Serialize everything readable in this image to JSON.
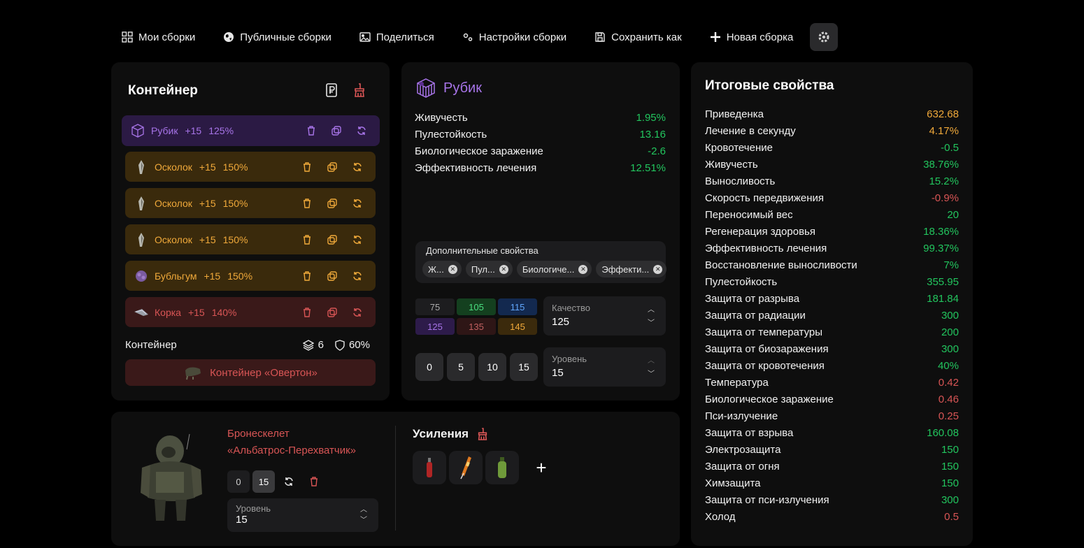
{
  "nav": {
    "my_builds": "Мои сборки",
    "public_builds": "Публичные сборки",
    "share": "Поделиться",
    "build_settings": "Настройки сборки",
    "save_as": "Сохранить как",
    "new_build": "Новая сборка"
  },
  "container": {
    "title": "Контейнер",
    "artifacts": [
      {
        "name": "Рубик",
        "level": "+15",
        "percent": "125%",
        "color": "purple",
        "icon": "rubik-icon"
      },
      {
        "name": "Осколок",
        "level": "+15",
        "percent": "150%",
        "color": "orange",
        "icon": "shard-icon"
      },
      {
        "name": "Осколок",
        "level": "+15",
        "percent": "150%",
        "color": "orange",
        "icon": "shard-icon"
      },
      {
        "name": "Осколок",
        "level": "+15",
        "percent": "150%",
        "color": "orange",
        "icon": "shard-icon"
      },
      {
        "name": "Бубльгум",
        "level": "+15",
        "percent": "150%",
        "color": "orange",
        "icon": "bubblegum-icon"
      },
      {
        "name": "Корка",
        "level": "+15",
        "percent": "140%",
        "color": "red",
        "icon": "crust-icon"
      }
    ],
    "summary_label": "Контейнер",
    "slots": "6",
    "protection": "60%",
    "container_item": "Контейнер «Овертон»"
  },
  "rubik": {
    "title": "Рубик",
    "stats": [
      {
        "name": "Живучесть",
        "value": "1.95%",
        "color": "green"
      },
      {
        "name": "Пулестойкость",
        "value": "13.16",
        "color": "green"
      },
      {
        "name": "Биологическое заражение",
        "value": "-2.6",
        "color": "green"
      },
      {
        "name": "Эффективность лечения",
        "value": "12.51%",
        "color": "green"
      }
    ],
    "extra_label": "Дополнительные свойства",
    "chips": [
      "Ж...",
      "Пул...",
      "Биологиче...",
      "Эффекти..."
    ],
    "quality_values": [
      "75",
      "105",
      "115",
      "125",
      "135",
      "145"
    ],
    "quality_label": "Качество",
    "quality_value": "125",
    "level_buttons": [
      "0",
      "5",
      "10",
      "15"
    ],
    "level_label": "Уровень",
    "level_value": "15"
  },
  "totals": {
    "title": "Итоговые свойства",
    "stats": [
      {
        "name": "Приведенка",
        "value": "632.68",
        "color": "orange"
      },
      {
        "name": "Лечение в секунду",
        "value": "4.17%",
        "color": "orange"
      },
      {
        "name": "Кровотечение",
        "value": "-0.5",
        "color": "green"
      },
      {
        "name": "Живучесть",
        "value": "38.76%",
        "color": "green"
      },
      {
        "name": "Выносливость",
        "value": "15.2%",
        "color": "green"
      },
      {
        "name": "Скорость передвижения",
        "value": "-0.9%",
        "color": "red"
      },
      {
        "name": "Переносимый вес",
        "value": "20",
        "color": "green"
      },
      {
        "name": "Регенерация здоровья",
        "value": "18.36%",
        "color": "green"
      },
      {
        "name": "Эффективность лечения",
        "value": "99.37%",
        "color": "green"
      },
      {
        "name": "Восстановление выносливости",
        "value": "7%",
        "color": "green"
      },
      {
        "name": "Пулестойкость",
        "value": "355.95",
        "color": "green"
      },
      {
        "name": "Защита от разрыва",
        "value": "181.84",
        "color": "green"
      },
      {
        "name": "Защита от радиации",
        "value": "300",
        "color": "green"
      },
      {
        "name": "Защита от температуры",
        "value": "200",
        "color": "green"
      },
      {
        "name": "Защита от биозаражения",
        "value": "300",
        "color": "green"
      },
      {
        "name": "Защита от кровотечения",
        "value": "40%",
        "color": "green"
      },
      {
        "name": "Температура",
        "value": "0.42",
        "color": "red"
      },
      {
        "name": "Биологическое заражение",
        "value": "0.46",
        "color": "red"
      },
      {
        "name": "Пси-излучение",
        "value": "0.25",
        "color": "red"
      },
      {
        "name": "Защита от взрыва",
        "value": "160.08",
        "color": "green"
      },
      {
        "name": "Электрозащита",
        "value": "150",
        "color": "green"
      },
      {
        "name": "Защита от огня",
        "value": "150",
        "color": "green"
      },
      {
        "name": "Химзащита",
        "value": "150",
        "color": "green"
      },
      {
        "name": "Защита от пси-излучения",
        "value": "300",
        "color": "green"
      },
      {
        "name": "Холод",
        "value": "0.5",
        "color": "red"
      }
    ]
  },
  "armor": {
    "name_line1": "Бронескелет",
    "name_line2": "«Альбатрос-Перехватчик»",
    "level_buttons": [
      "0",
      "15"
    ],
    "level_label": "Уровень",
    "level_value": "15"
  },
  "boosts": {
    "title": "Усиления",
    "items": [
      "red-spray-icon",
      "orange-syringe-icon",
      "green-bottle-icon"
    ],
    "add_label": "+"
  }
}
